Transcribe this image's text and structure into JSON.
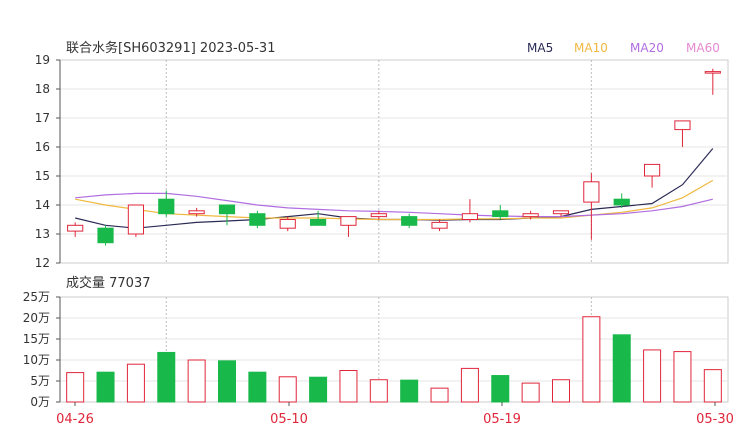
{
  "header": {
    "stock_title": "联合水务[SH603291] 2023-05-31",
    "volume_title": "成交量 77037"
  },
  "legend": [
    {
      "label": "MA5",
      "color": "#2b2b55"
    },
    {
      "label": "MA10",
      "color": "#f0b840"
    },
    {
      "label": "MA20",
      "color": "#b06ee0"
    },
    {
      "label": "MA60",
      "color": "#e58ad2"
    }
  ],
  "colors": {
    "up": "#e0263a",
    "down": "#18b94a",
    "grid": "#cccccc",
    "axis": "#555555"
  },
  "chart_data": [
    {
      "type": "candlestick",
      "title": "联合水务[SH603291] 2023-05-31",
      "ylim": [
        12,
        19
      ],
      "yticks": [
        "19",
        "18",
        "17",
        "16",
        "15",
        "14",
        "13",
        "12"
      ],
      "x_tick_labels": [
        "04-26",
        "05-10",
        "05-19",
        "05-30"
      ],
      "candles": [
        {
          "date": "04-26",
          "open": 13.1,
          "high": 13.4,
          "low": 12.9,
          "close": 13.3
        },
        {
          "date": "04-27",
          "open": 13.2,
          "high": 13.3,
          "low": 12.6,
          "close": 12.7
        },
        {
          "date": "04-28",
          "open": 13.0,
          "high": 14.0,
          "low": 12.9,
          "close": 14.0
        },
        {
          "date": "05-04",
          "open": 14.2,
          "high": 14.5,
          "low": 13.6,
          "close": 13.7
        },
        {
          "date": "05-05",
          "open": 13.7,
          "high": 13.9,
          "low": 13.6,
          "close": 13.8
        },
        {
          "date": "05-08",
          "open": 14.0,
          "high": 14.0,
          "low": 13.3,
          "close": 13.7
        },
        {
          "date": "05-09",
          "open": 13.7,
          "high": 13.8,
          "low": 13.2,
          "close": 13.3
        },
        {
          "date": "05-10",
          "open": 13.2,
          "high": 13.6,
          "low": 13.1,
          "close": 13.5
        },
        {
          "date": "05-11",
          "open": 13.5,
          "high": 13.8,
          "low": 13.3,
          "close": 13.3
        },
        {
          "date": "05-12",
          "open": 13.3,
          "high": 13.6,
          "low": 12.9,
          "close": 13.6
        },
        {
          "date": "05-15",
          "open": 13.6,
          "high": 13.8,
          "low": 13.5,
          "close": 13.7
        },
        {
          "date": "05-16",
          "open": 13.6,
          "high": 13.7,
          "low": 13.2,
          "close": 13.3
        },
        {
          "date": "05-17",
          "open": 13.2,
          "high": 13.5,
          "low": 13.1,
          "close": 13.4
        },
        {
          "date": "05-18",
          "open": 13.5,
          "high": 14.2,
          "low": 13.4,
          "close": 13.7
        },
        {
          "date": "05-19",
          "open": 13.8,
          "high": 14.0,
          "low": 13.5,
          "close": 13.6
        },
        {
          "date": "05-22",
          "open": 13.6,
          "high": 13.8,
          "low": 13.5,
          "close": 13.7
        },
        {
          "date": "05-23",
          "open": 13.7,
          "high": 13.8,
          "low": 13.6,
          "close": 13.8
        },
        {
          "date": "05-24",
          "open": 14.1,
          "high": 15.1,
          "low": 12.8,
          "close": 14.8
        },
        {
          "date": "05-25",
          "open": 14.2,
          "high": 14.4,
          "low": 13.9,
          "close": 14.0
        },
        {
          "date": "05-26",
          "open": 15.0,
          "high": 15.4,
          "low": 14.6,
          "close": 15.4
        },
        {
          "date": "05-29",
          "open": 16.6,
          "high": 16.9,
          "low": 16.0,
          "close": 16.9
        },
        {
          "date": "05-30",
          "open": 18.6,
          "high": 18.7,
          "low": 17.8,
          "close": 18.6
        }
      ],
      "series": [
        {
          "name": "MA5",
          "values": [
            13.55,
            13.3,
            13.2,
            13.3,
            13.4,
            13.45,
            13.5,
            13.6,
            13.7,
            13.55,
            13.5,
            13.5,
            13.48,
            13.5,
            13.5,
            13.55,
            13.6,
            13.85,
            13.95,
            14.05,
            14.7,
            15.95
          ]
        },
        {
          "name": "MA10",
          "values": [
            14.2,
            14.0,
            13.85,
            13.7,
            13.65,
            13.6,
            13.55,
            13.55,
            13.55,
            13.52,
            13.5,
            13.5,
            13.5,
            13.52,
            13.52,
            13.55,
            13.55,
            13.65,
            13.75,
            13.9,
            14.25,
            14.85
          ]
        },
        {
          "name": "MA20",
          "values": [
            14.25,
            14.35,
            14.4,
            14.4,
            14.3,
            14.15,
            14.0,
            13.9,
            13.85,
            13.8,
            13.78,
            13.75,
            13.7,
            13.65,
            13.62,
            13.6,
            13.6,
            13.65,
            13.7,
            13.8,
            13.95,
            14.2
          ]
        }
      ]
    },
    {
      "type": "bar",
      "title": "成交量 77037",
      "ylim": [
        0,
        250000
      ],
      "yticks": [
        "25万",
        "20万",
        "15万",
        "10万",
        "5万",
        "0万"
      ],
      "categories": [
        "04-26",
        "04-27",
        "04-28",
        "05-04",
        "05-05",
        "05-08",
        "05-09",
        "05-10",
        "05-11",
        "05-12",
        "05-15",
        "05-16",
        "05-17",
        "05-18",
        "05-19",
        "05-22",
        "05-23",
        "05-24",
        "05-25",
        "05-26",
        "05-29",
        "05-30"
      ],
      "values": [
        70000,
        71000,
        90000,
        118000,
        100000,
        98000,
        71000,
        60000,
        59000,
        75000,
        53000,
        52000,
        33000,
        80000,
        63000,
        45000,
        53000,
        203000,
        160000,
        124000,
        120000,
        77037
      ],
      "direction": [
        "up",
        "down",
        "up",
        "down",
        "up",
        "down",
        "down",
        "up",
        "down",
        "up",
        "up",
        "down",
        "up",
        "up",
        "down",
        "up",
        "up",
        "up",
        "down",
        "up",
        "up",
        "up"
      ]
    }
  ]
}
